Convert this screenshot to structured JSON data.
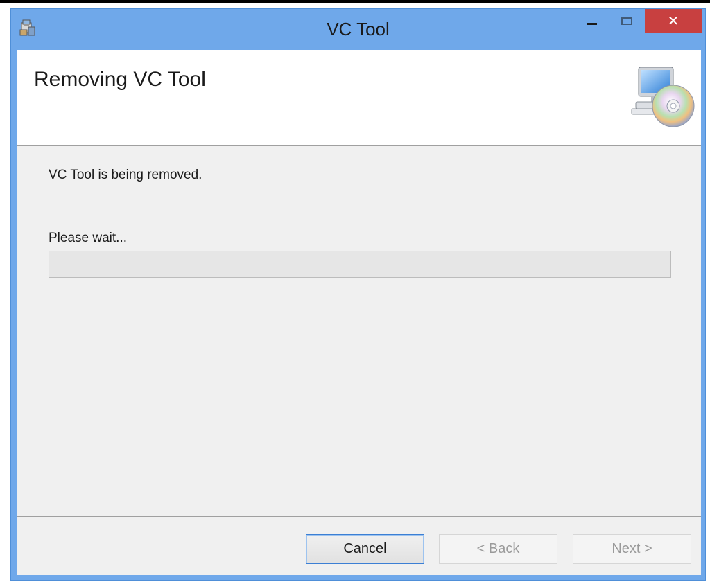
{
  "window": {
    "title": "VC Tool",
    "close_glyph": "✕",
    "app_icon": "installer-package-icon"
  },
  "header": {
    "title": "Removing VC Tool",
    "graphic": "computer-cd-icon"
  },
  "body": {
    "status": "VC Tool is being removed.",
    "wait_label": "Please wait...",
    "progress_percent": 0
  },
  "buttons": {
    "cancel": "Cancel",
    "back": "< Back",
    "next": "Next >"
  },
  "colors": {
    "titlebar": "#6fa8ea",
    "close_button": "#c84040",
    "dialog_body": "#f0f0f0",
    "focus_border": "#3c7fd4"
  }
}
